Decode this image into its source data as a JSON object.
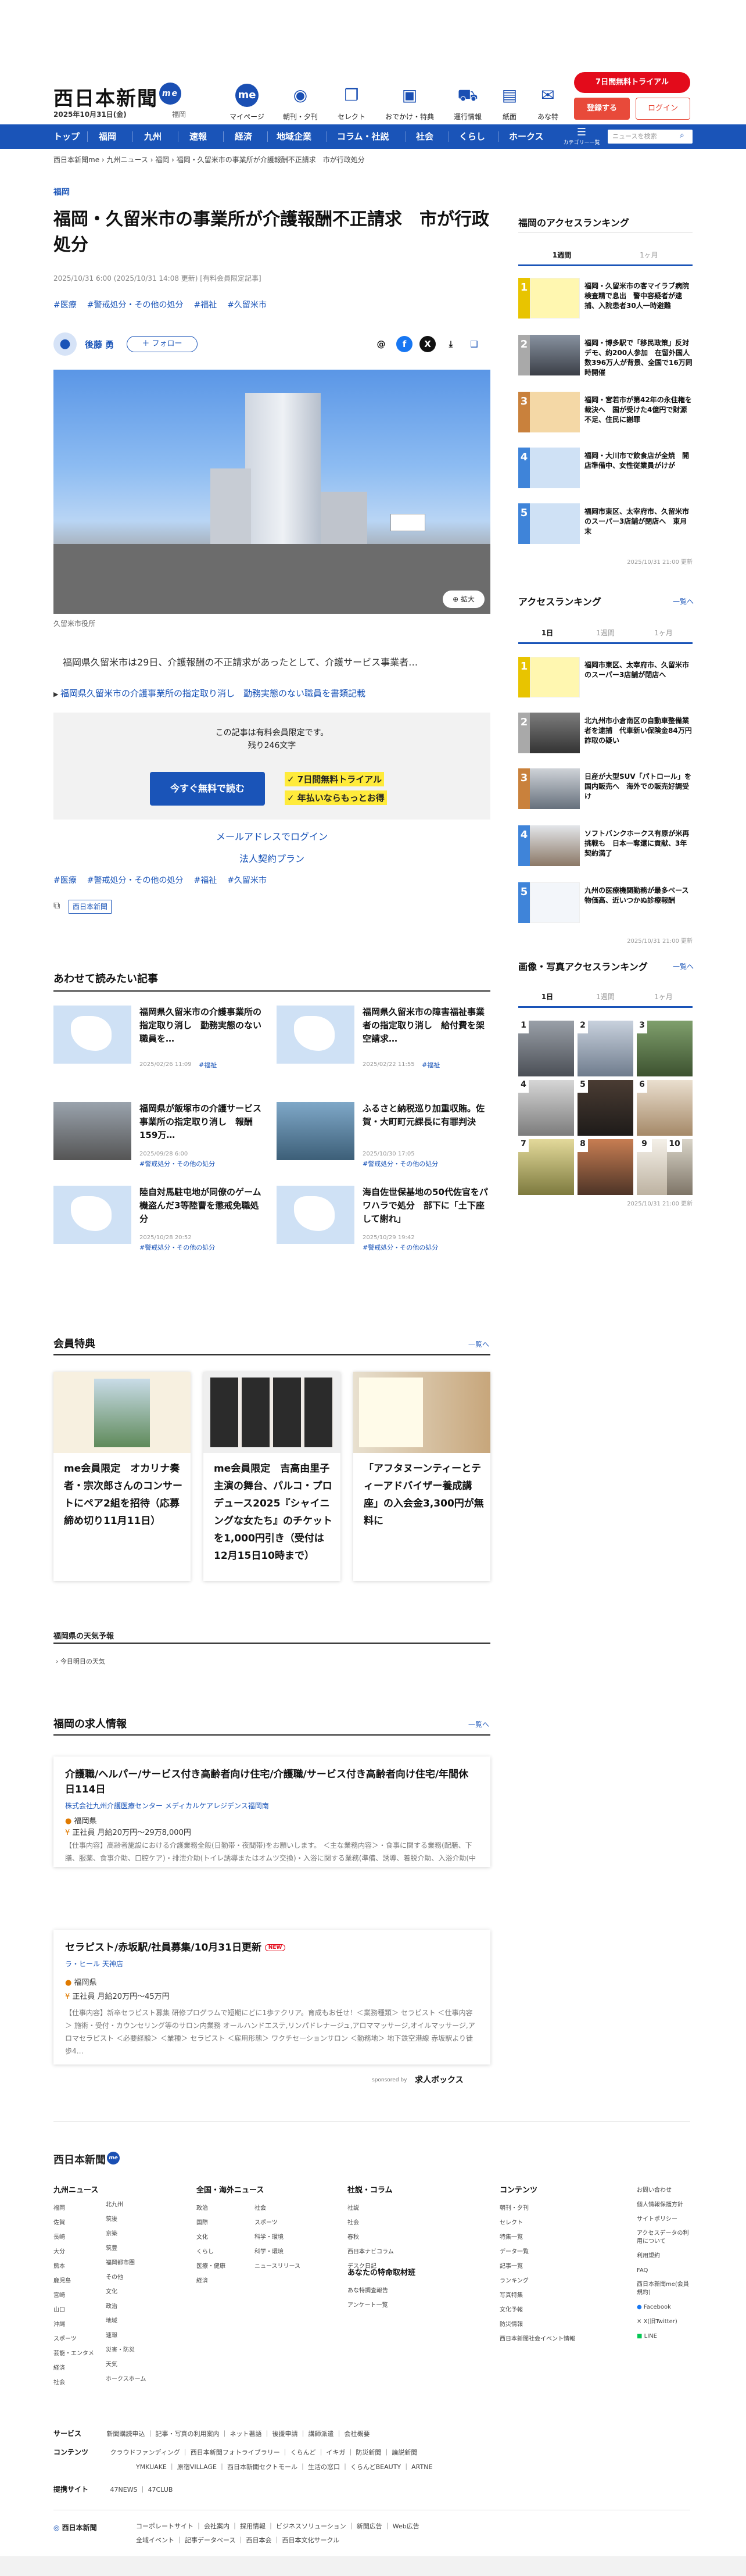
{
  "header": {
    "logo": "西日本新聞",
    "logo_badge": "me",
    "date": "2025年10月31日(金)",
    "region": "福岡",
    "nav": [
      {
        "label": "マイページ",
        "icon": "me"
      },
      {
        "label": "朝刊・夕刊",
        "icon": "newspaper-icon"
      },
      {
        "label": "セレクト",
        "icon": "bookmark-icon"
      },
      {
        "label": "おでかけ・特典",
        "icon": "gift-icon"
      },
      {
        "label": "運行情報",
        "icon": "train-icon"
      },
      {
        "label": "紙面",
        "icon": "paper-icon"
      },
      {
        "label": "あな特",
        "icon": "mail-icon"
      }
    ],
    "trial": "7日間無料トライアル",
    "register": "登録する",
    "login": "ログイン"
  },
  "menu": {
    "items": [
      "トップ",
      "福岡",
      "九州",
      "速報",
      "経済",
      "地域企業",
      "コラム・社説",
      "社会",
      "くらし",
      "ホークス"
    ],
    "category": "カテゴリー一覧",
    "search_placeholder": "ニュースを検索"
  },
  "breadcrumb": "西日本新聞me  ›  九州ニュース  ›  福岡  ›  福岡・久留米市の事業所が介護報酬不正請求　市が行政処分",
  "article": {
    "section": "福岡",
    "title": "福岡・久留米市の事業所が介護報酬不正請求　市が行政処分",
    "meta": "2025/10/31 6:00 (2025/10/31 14:08 更新)  [有料会員限定記事]",
    "tags": [
      "#医療",
      "#警戒処分・その他の処分",
      "#福祉",
      "#久留米市"
    ],
    "author": "後藤 勇",
    "follow": "＋ フォロー",
    "photo_zoom": "⊕ 拡大",
    "caption": "久留米市役所",
    "lead": "福岡県久留米市は29日、介護報酬の不正請求があったとして、介護サービス事業者…",
    "related": "福岡県久留米市の介護事業所の指定取り消し　勤務実態のない職員を書類記載",
    "paywall": {
      "line1": "この記事は有料会員限定です。",
      "line2": "残り246文字",
      "button": "今すぐ無料で読む",
      "hl1": "✓ 7日間無料トライアル",
      "hl2": "✓ 年払いならもっとお得",
      "mail_login": "メールアドレスでログイン",
      "corp": "法人契約プラン"
    },
    "tags2": [
      "#医療",
      "#警戒処分・その他の処分",
      "#福祉",
      "#久留米市"
    ],
    "source_badge": "西日本新聞"
  },
  "recommended": {
    "heading": "あわせて読みたい記事",
    "items": [
      {
        "title": "福岡県久留米市の介護事業所の指定取り消し　勤務実態のない職員を…",
        "tag": "#福祉",
        "date": "2025/02/26 11:09"
      },
      {
        "title": "福岡県久留米市の障害福祉事業者の指定取り消し　給付費を架空請求…",
        "tag": "#福祉",
        "date": "2025/02/22 11:55"
      },
      {
        "title": "福岡県が飯塚市の介護サービス事業所の指定取り消し　報酬159万…",
        "tag": "#警戒処分・その他の処分",
        "date": "2025/09/28 6:00"
      },
      {
        "title": "ふるさと納税巡り加重収賄。佐賀・大町町元課長に有罪判決",
        "tag": "#警戒処分・その他の処分",
        "date": "2025/10/30 17:05"
      },
      {
        "title": "陸自対馬駐屯地が同僚のゲーム機盗んだ3等陸曹を懲戒免職処分",
        "tag": "#警戒処分・その他の処分",
        "date": "2025/10/28 20:52"
      },
      {
        "title": "海自佐世保基地の50代佐官をパワハラで処分　部下に「土下座して謝れ」",
        "tag": "#警戒処分・その他の処分",
        "date": "2025/10/29 19:42"
      }
    ]
  },
  "perks": {
    "heading": "会員特典",
    "more": "一覧へ",
    "items": [
      {
        "text": "me会員限定　オカリナ奏者・宗次郎さんのコンサートにペア2組を招待（応募締め切り11月11日）"
      },
      {
        "text": "me会員限定　吉高由里子主演の舞台、パルコ・プロデュース2025『シャイニングな女たち』のチケットを1,000円引き（受付は12月15日10時まで）"
      },
      {
        "text": "「アフタヌーンティーとティーアドバイザー養成講座」の入会金3,300円が無料に"
      }
    ]
  },
  "weather": {
    "heading": "福岡県の天気予報",
    "sub": "今日明日の天気"
  },
  "jobs": {
    "heading": "福岡の求人情報",
    "more": "一覧へ",
    "items": [
      {
        "title": "介護職/ヘルパー/サービス付き高齢者向け住宅/介護職/サービス付き高齢者向け住宅/年間休日114日",
        "company": "株式会社九州介護医療センター メディカルケアレジデンス福岡南",
        "loc": "福岡県",
        "pay": "正社員 月給20万円〜29万8,000円",
        "desc": "【仕事内容】高齢者施設における介護業務全般(日勤帯・夜間帯)をお願いします。 ＜主な業務内容＞・食事に関する業務(配膳、下膳、服薬、食事介助、口腔ケア)・排泄介助(トイレ誘導またはオムツ交換)・入浴に関する業務(準備、誘導、着脱介助、入浴介助(中介)・トランスバッド、乗イス、ストレッチャーなど)・移動に関するリビングやホームへの誘導・健康の他、副業の仕事・ナースコールの対応…"
      },
      {
        "title": "セラピスト/赤坂駅/社員募集/10月31日更新",
        "badge": "NEW",
        "company": "ラ・ヒール 天神店",
        "loc": "福岡県",
        "pay": "正社員 月給20万円〜45万円",
        "desc": "【仕事内容】新卒セラピスト募集 研修プログラムで短期にどに1歩テクリア。育成もお任せ！＜業務種類＞ セラピスト ＜仕事内容＞ 施術・受付・カウンセリング等のサロン内業務 オールハンドエステ,リンパドレナージュ,アロママッサージ,オイルマッサージ,アロマセラピスト ＜必要経験＞ ＜業種＞ セラピスト ＜雇用形態＞ ワクチセーションサロン ＜勤務地＞ 地下鉄空港線 赤坂駅より徒歩4…"
      }
    ],
    "sponsor": "sponsored by",
    "sponsor_name": "求人ボックス"
  },
  "sidebar": {
    "fukuoka_rank": {
      "heading": "福岡のアクセスランキング",
      "tabs": [
        "1週間",
        "1ヶ月"
      ],
      "items": [
        "福岡・久留米市の客マイラブ病院検査精で息出　警中容疑者が逮捕、入院患者30人一時避難",
        "福岡・博多駅で「移民政策」反対デモ、約200人参加　在留外国人数396万人が背景、全国で16万同時開催",
        "福岡・宮若市が第42年の永住権を裁決へ　国が受けた4億円で財源不足、住民に謝罪",
        "福岡・大川市で飲食店が全焼　開店準備中、女性従業員がけが",
        "福岡市東区、太宰府市、久留米市のスーパー3店舗が閉店へ　東月末"
      ],
      "updated": "2025/10/31 21:00 更新"
    },
    "access_rank": {
      "heading": "アクセスランキング",
      "more": "一覧へ",
      "tabs": [
        "1日",
        "1週間",
        "1ヶ月"
      ],
      "items": [
        "福岡市東区、太宰府市、久留米市のスーパー3店舗が閉店へ",
        "北九州市小倉南区の自動車整備業者を逮捕　代車新い保険金84万円詐取の疑い",
        "日産が大型SUV「パトロール」を国内販売へ　海外での販売好調受け",
        "ソフトバンクホークス有原が米再挑戦も　日本一奪還に貢献、3年契約満了",
        "九州の医療機関勤務が最多ペース　物価高、近いつかぬ診療報酬"
      ],
      "updated": "2025/10/31 21:00 更新"
    },
    "photo_rank": {
      "heading": "画像・写真アクセスランキング",
      "more": "一覧へ",
      "tabs": [
        "1日",
        "1週間",
        "1ヶ月"
      ],
      "nums": [
        "1",
        "2",
        "3",
        "4",
        "5",
        "6",
        "7",
        "8",
        "9",
        "10"
      ],
      "updated": "2025/10/31 21:00 更新"
    }
  },
  "footer": {
    "logo": "西日本新聞",
    "logo_badge": "me",
    "cols": [
      {
        "h": "九州ニュース",
        "items": [
          "福岡",
          "佐賀",
          "長崎",
          "大分",
          "熊本",
          "鹿児島",
          "宮崎",
          "山口",
          "沖縄",
          "スポーツ",
          "芸能・エンタメ",
          "経済",
          "社会"
        ]
      },
      {
        "h": "",
        "items": [
          "北九州",
          "筑後",
          "京築",
          "筑豊",
          "福岡都市圏",
          "その他",
          "文化",
          "政治",
          "地域",
          "速報",
          "災害・防災",
          "天気",
          "ホークスホーム"
        ]
      },
      {
        "h": "全国・海外ニュース",
        "items": [
          "政治",
          "国際",
          "文化",
          "くらし",
          "医療・健康",
          "経済",
          "社会",
          "スポーツ",
          "科学・環境",
          "科学・環境",
          "ニュースリリース"
        ]
      },
      {
        "h": "社説・コラム",
        "items": [
          "社説",
          "社会",
          "春秋",
          "西日本ナビコラム",
          "デスク日記"
        ]
      },
      {
        "h": "あなたの特命取材班",
        "items": [
          "あな特調査報告",
          "アンケート一覧"
        ]
      },
      {
        "h": "コンテンツ",
        "items": [
          "朝刊・夕刊",
          "セレクト",
          "特集一覧",
          "データ一覧",
          "記事一覧",
          "ランキング",
          "写真特集",
          "文化予報",
          "防災情報",
          "西日本新聞社会イベント情報"
        ]
      },
      {
        "h": "",
        "items": [
          "お問い合わせ",
          "個人情報保護方針",
          "サイトポリシー",
          "アクセスデータの利用について",
          "利用規約",
          "FAQ",
          "西日本新聞me(会員規約)",
          "Facebook",
          "X(旧Twitter)",
          "LINE"
        ]
      }
    ],
    "services_h": "サービス",
    "services": [
      "新聞購読申込",
      "記事・写真の利用案内",
      "ネット著語",
      "後援申請",
      "講師派遣",
      "会社概要"
    ],
    "contents_h": "コンテンツ",
    "contents": [
      "クラウドファンディング",
      "西日本新聞フォトライブラリー",
      "くらんど",
      "イキガ",
      "防災新聞",
      "論説新聞",
      "YMKUAKE",
      "原宿VILLAGE",
      "西日本新聞セクトモール",
      "生活の窓口",
      "くらんどBEAUTY",
      "ARTNE"
    ],
    "partner_h": "提携サイト",
    "partners": [
      "47NEWS",
      "47CLUB"
    ],
    "corp": "西日本新聞",
    "corp_links": [
      "コーポレートサイト",
      "会社案内",
      "採用情報",
      "ビジネスソリューション",
      "新聞広告",
      "Web広告",
      "全域イベント",
      "記事データベース",
      "西日本会",
      "西日本文化サークル"
    ]
  }
}
